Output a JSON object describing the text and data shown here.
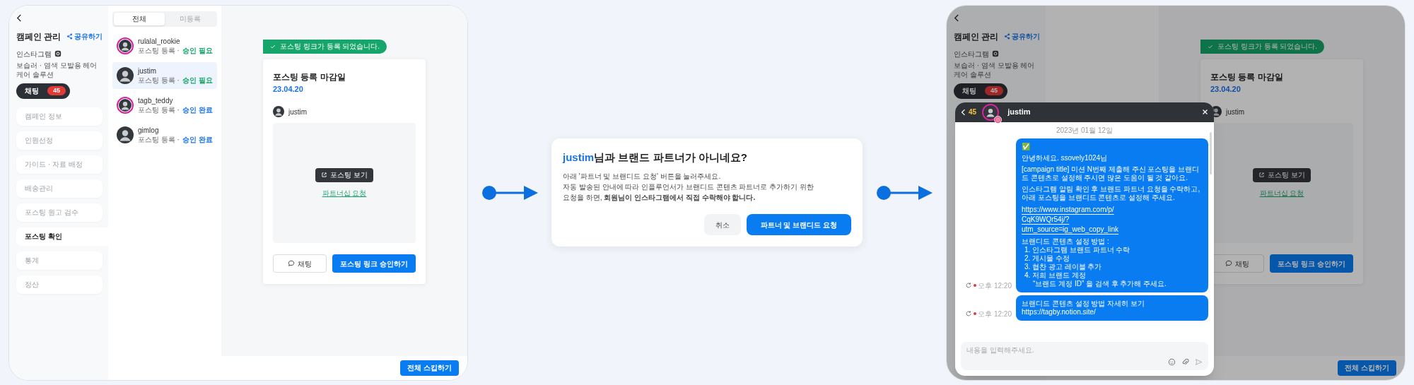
{
  "screen_before": {
    "sidebar": {
      "title": "캠페인 관리",
      "share": "공유하기",
      "platform": "인스타그램",
      "campaign": "보습러 · 염색 모발용 헤어 케어 솔루션",
      "chat_button": {
        "label": "채팅",
        "count": "45"
      },
      "items": [
        {
          "label": "캠페인 정보",
          "selected": false
        },
        {
          "label": "인원선정",
          "selected": false
        },
        {
          "label": "가이드 · 자료 배정",
          "selected": false
        },
        {
          "label": "배송관리",
          "selected": false
        },
        {
          "label": "포스팅 원고 검수",
          "selected": false
        },
        {
          "label": "포스팅 확인",
          "selected": true
        },
        {
          "label": "통계",
          "selected": false
        },
        {
          "label": "정산",
          "selected": false
        }
      ]
    },
    "tabs": [
      {
        "label": "전체",
        "selected": true
      },
      {
        "label": "미등록",
        "selected": false
      }
    ],
    "influencers": [
      {
        "name": "rulalal_rookie",
        "ring": true,
        "status": "포스팅 등록 ·",
        "approval": "승인 필요",
        "color": "#16a56a",
        "selected": false
      },
      {
        "name": "justim",
        "ring": false,
        "status": "포스팅 등록 ·",
        "approval": "승인 필요",
        "color": "#16a56a",
        "selected": true
      },
      {
        "name": "tagb_teddy",
        "ring": true,
        "status": "포스팅 등록 ·",
        "approval": "승인 완료",
        "color": "#1a73e8",
        "selected": false
      },
      {
        "name": "gimlog",
        "ring": false,
        "status": "포스팅 등록 ·",
        "approval": "승인 완료",
        "color": "#1a73e8",
        "selected": false
      }
    ],
    "toast": "포스팅 링크가 등록 되었습니다.",
    "card": {
      "title": "포스팅 등록 마감일",
      "date": "23.04.20",
      "user": "justim",
      "view_button": "포스팅 보기",
      "partnership_link": "파트너십 요청",
      "chat_button": "채팅",
      "approve_button": "포스팅 링크 승인하기"
    },
    "skip_button": "전체 스킵하기"
  },
  "dialog": {
    "highlight": "justim",
    "title": "님과 브랜드 파트너가 아니네요?",
    "body_lines": [
      "아래 '파트너 및 브랜디드 요청' 버튼을 눌러주세요.",
      "자동 발송된 안내에 따라 인플루언서가 브랜디드 콘텐츠 파트너로 추가하기 위한",
      "요청을 하면, **회원님이 인스타그램에서 직접 수락해야 합니다.**"
    ],
    "cancel_button": "취소",
    "confirm_button": "파트너 및 브랜디드 요청"
  },
  "screen_after": {
    "sidebar": {
      "title": "캠페인 관리",
      "share": "공유하기",
      "platform": "인스타그램",
      "campaign": "보습러 · 염색 모발용 헤어 케어 솔루션",
      "chat_button": {
        "label": "채팅",
        "count": "45"
      }
    },
    "toast": "포스팅 링크가 등록 되었습니다.",
    "card": {
      "title": "포스팅 등록 마감일",
      "date": "23.04.20",
      "user": "justim",
      "view_button": "포스팅 보기",
      "partnership_link": "파트너십 요청",
      "chat_button": "채팅",
      "approve_button": "포스팅 링크 승인하기"
    },
    "skip_button": "전체 스킵하기",
    "chat": {
      "back_count": "45",
      "name": "justim",
      "date": "2023년 01월 12일",
      "placeholder": "내용을 입력해주세요.",
      "messages": [
        {
          "time": "오후 12:20",
          "failed": true,
          "blocks": [
            {
              "kind": "text",
              "lines": [
                "✅"
              ]
            },
            {
              "kind": "text",
              "lines": [
                "안녕하세요. ssovely1024님"
              ]
            },
            {
              "kind": "text",
              "lines": [
                "[campaign title] 미션 N번째 제출해 주신 포스팅을 브랜디드 콘텐츠로 설정해 주시면 많은 도움이 될 것 같아요."
              ]
            },
            {
              "kind": "text",
              "lines": [
                "인스타그램 알림 확인 후 브랜드 파트너 요청을 수락하고, 아래 포스팅을 브랜디드 콘텐츠로 설정해 주세요."
              ]
            },
            {
              "kind": "link",
              "lines": [
                "https://www.instagram.com/p/",
                "CqK9WQr54j/?",
                "utm_source=ig_web_copy_link"
              ]
            },
            {
              "kind": "steps",
              "title": "브랜디드 콘텐츠 설정 방법 :",
              "steps": [
                "1. 인스타그램 브랜드 파트너 수락",
                "2. 게시물 수정",
                "3. 협찬 광고 레이블 추가",
                "4. 저희 브랜드 계정"
              ],
              "note": "“브랜드 계정 ID” 을 검색 후 추가해 주세요."
            }
          ]
        },
        {
          "time": "오후 12:20",
          "failed": true,
          "blocks": [
            {
              "kind": "text",
              "lines": [
                "브랜디드 콘텐츠 설정 방법 자세히 보기",
                "https://tagby.notion.site/"
              ]
            }
          ]
        }
      ]
    }
  }
}
